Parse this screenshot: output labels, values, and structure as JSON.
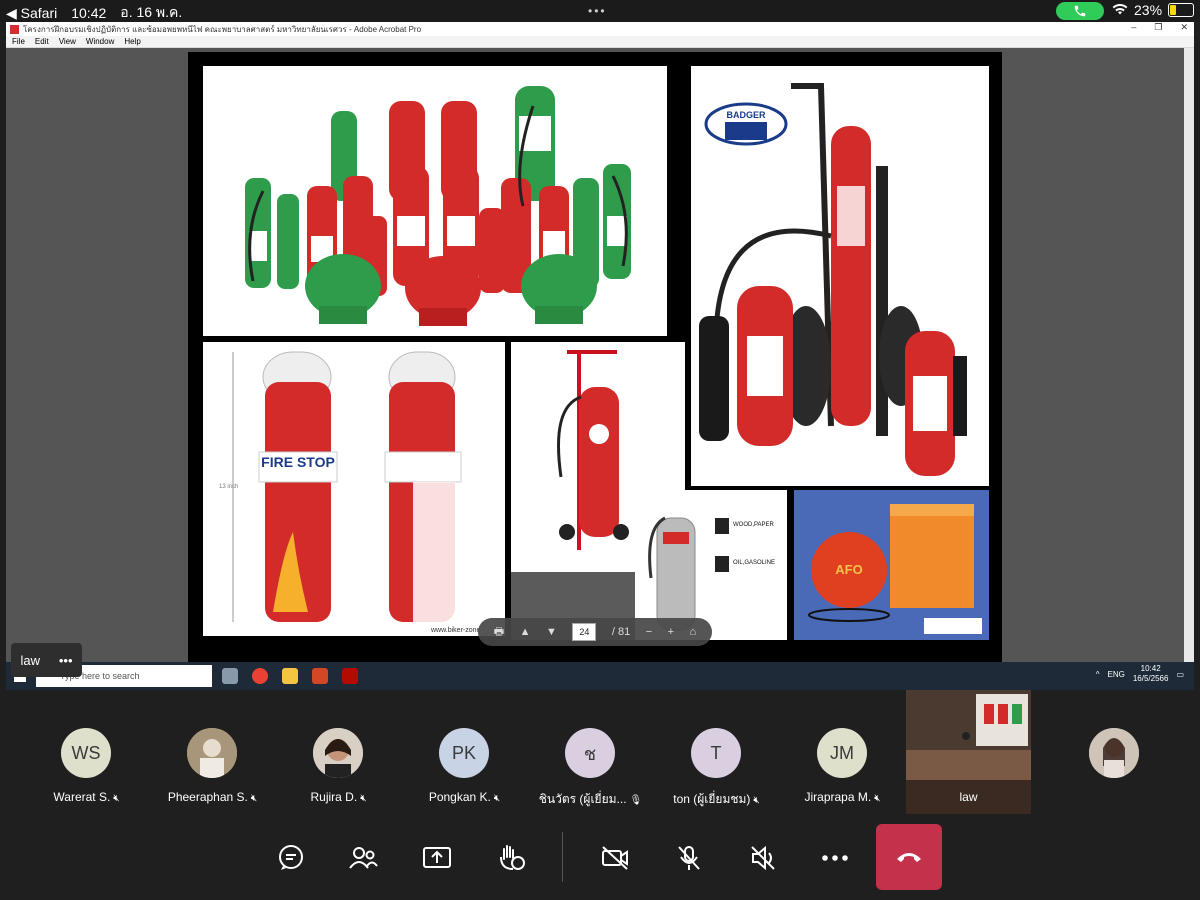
{
  "status_bar": {
    "back_app": "Safari",
    "time": "10:42",
    "date": "อ. 16 พ.ค.",
    "battery": "23%",
    "more_dots": "•••"
  },
  "acrobat": {
    "title": "โครงการฝึกอบรมเชิงปฏิบัติการ และซ้อมอพยพหนีไฟ คณะพยาบาลศาสตร์ มหาวิทยาลัยนเรศวร - Adobe Acrobat Pro",
    "menu": [
      "File",
      "Edit",
      "View",
      "Window",
      "Help"
    ],
    "win_min": "–",
    "win_restore": "❐",
    "win_close": "✕"
  },
  "slide": {
    "badger_logo": "BADGER",
    "fire_stop_text": "FIRE STOP",
    "fire_stop_size": "13 inch",
    "watermark": "www.biker-zone",
    "fireball_text": "AFO",
    "wood_label": "WOOD,PAPER",
    "oil_label": "OIL,GASOLINE"
  },
  "pdf_toolbar": {
    "current_page": "24",
    "total_pages": "/ 81"
  },
  "taskbar": {
    "search_placeholder": "Type here to search",
    "lang": "ENG",
    "clock_time": "10:42",
    "clock_date": "16/5/2566"
  },
  "pinned": {
    "name": "law",
    "more": "•••"
  },
  "participants": [
    {
      "initials": "WS",
      "name": "Warerat S.",
      "color": "#dfe0cc"
    },
    {
      "initials": "",
      "name": "Pheeraphan S.",
      "color": "#b7a991"
    },
    {
      "initials": "",
      "name": "Rujira D.",
      "color": "#c7a68c"
    },
    {
      "initials": "PK",
      "name": "Pongkan K.",
      "color": "#c9d3e6"
    },
    {
      "initials": "ช",
      "name": "ชินวัตร (ผู้เยี่ยม...",
      "color": "#d9cfe0"
    },
    {
      "initials": "T",
      "name": "ton (ผู้เยี่ยมชม)",
      "color": "#d9cfe0"
    },
    {
      "initials": "JM",
      "name": "Jiraprapa M.",
      "color": "#dfe0cc"
    }
  ],
  "video_tile": {
    "name": "law"
  },
  "colors": {
    "hangup": "#c4314b",
    "call_pill": "#2fcc5a",
    "battery": "#ffd60a"
  }
}
